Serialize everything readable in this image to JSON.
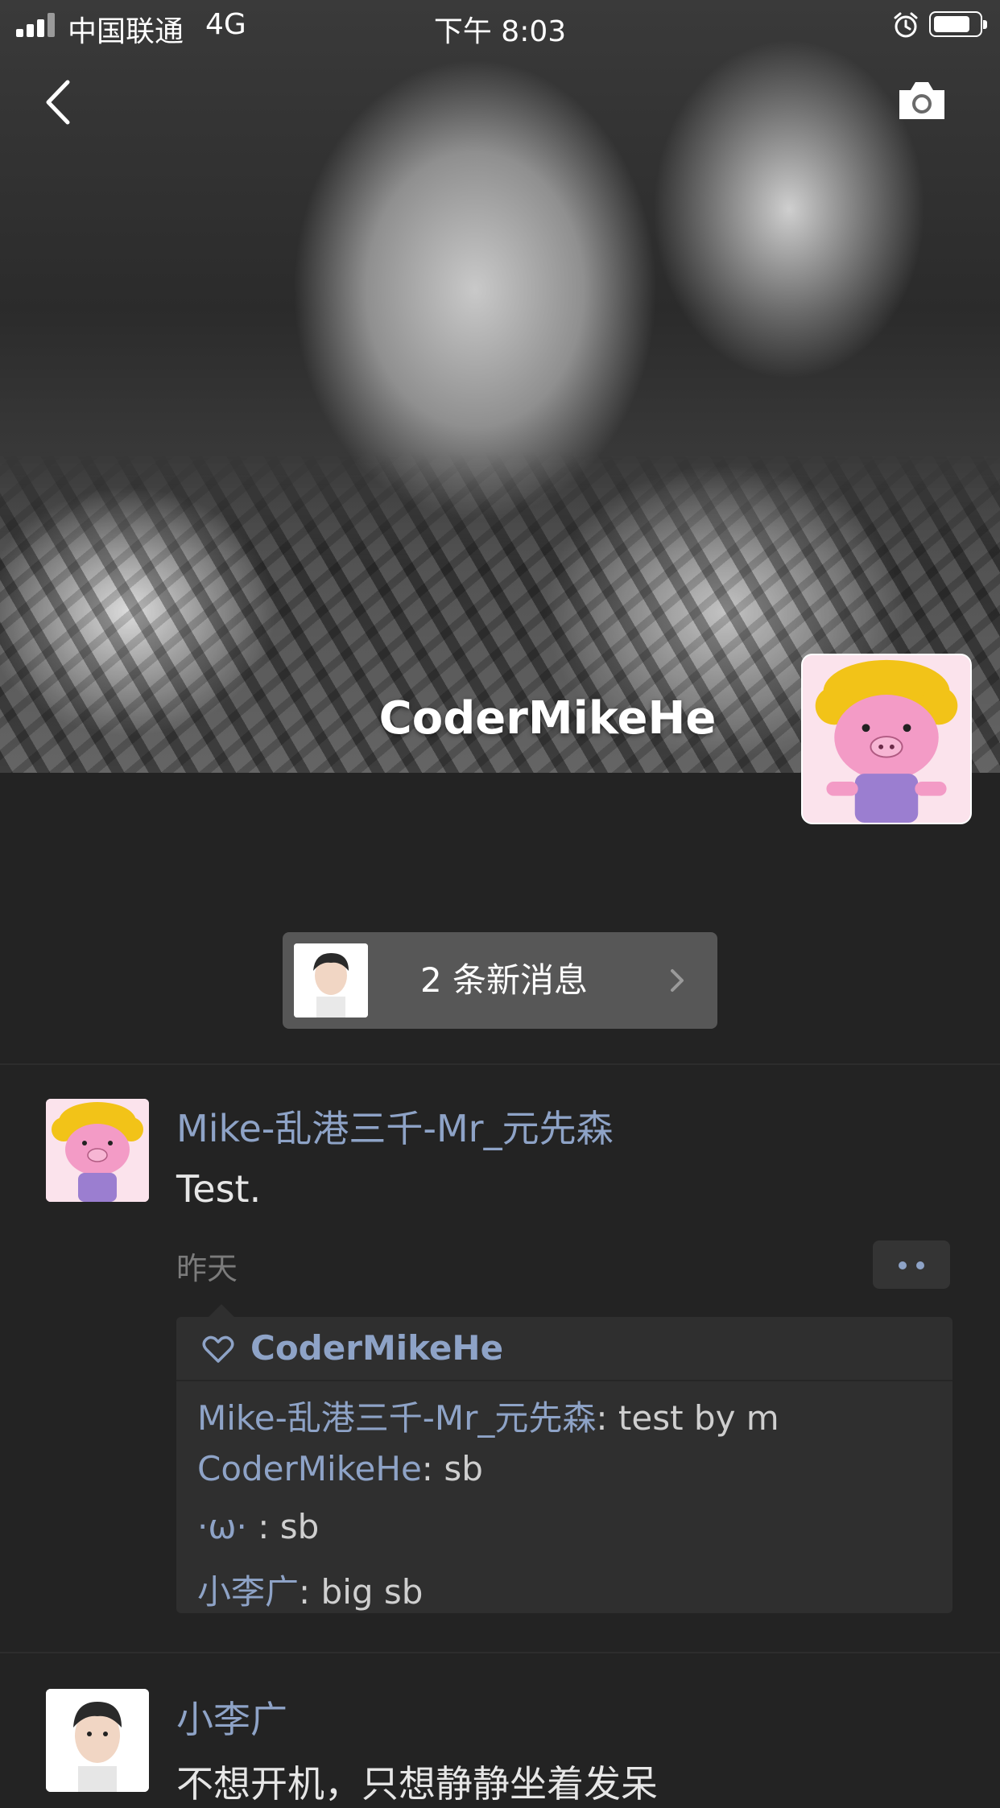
{
  "status_bar": {
    "carrier": "中国联通",
    "network": "4G",
    "time": "下午 8:03"
  },
  "profile": {
    "username": "CoderMikeHe"
  },
  "new_messages": {
    "label": "2 条新消息"
  },
  "posts": [
    {
      "author": "Mike-乱港三千-Mr_元先森",
      "text": "Test.",
      "time": "昨天",
      "likes": [
        "CoderMikeHe"
      ],
      "comments": [
        {
          "author": "Mike-乱港三千-Mr_元先森",
          "sep": ": ",
          "text": "test by m"
        },
        {
          "author": "CoderMikeHe",
          "sep": ": ",
          "text": "sb"
        },
        {
          "author": "·ω·",
          "sep": " : ",
          "text": "sb"
        },
        {
          "author": "小李广",
          "sep": ": ",
          "text": "big sb"
        }
      ]
    },
    {
      "author": "小李广",
      "text": "不想开机，只想静静坐着发呆"
    }
  ],
  "icons": {
    "back": "chevron-left-icon",
    "camera": "camera-icon",
    "more": "more-dots-icon",
    "like": "heart-icon",
    "arrow": "chevron-right-icon"
  },
  "colors": {
    "background": "#232323",
    "link_blue": "#8ea3c7",
    "pill_bg": "#575757",
    "comment_bg": "#2f2f2f"
  }
}
